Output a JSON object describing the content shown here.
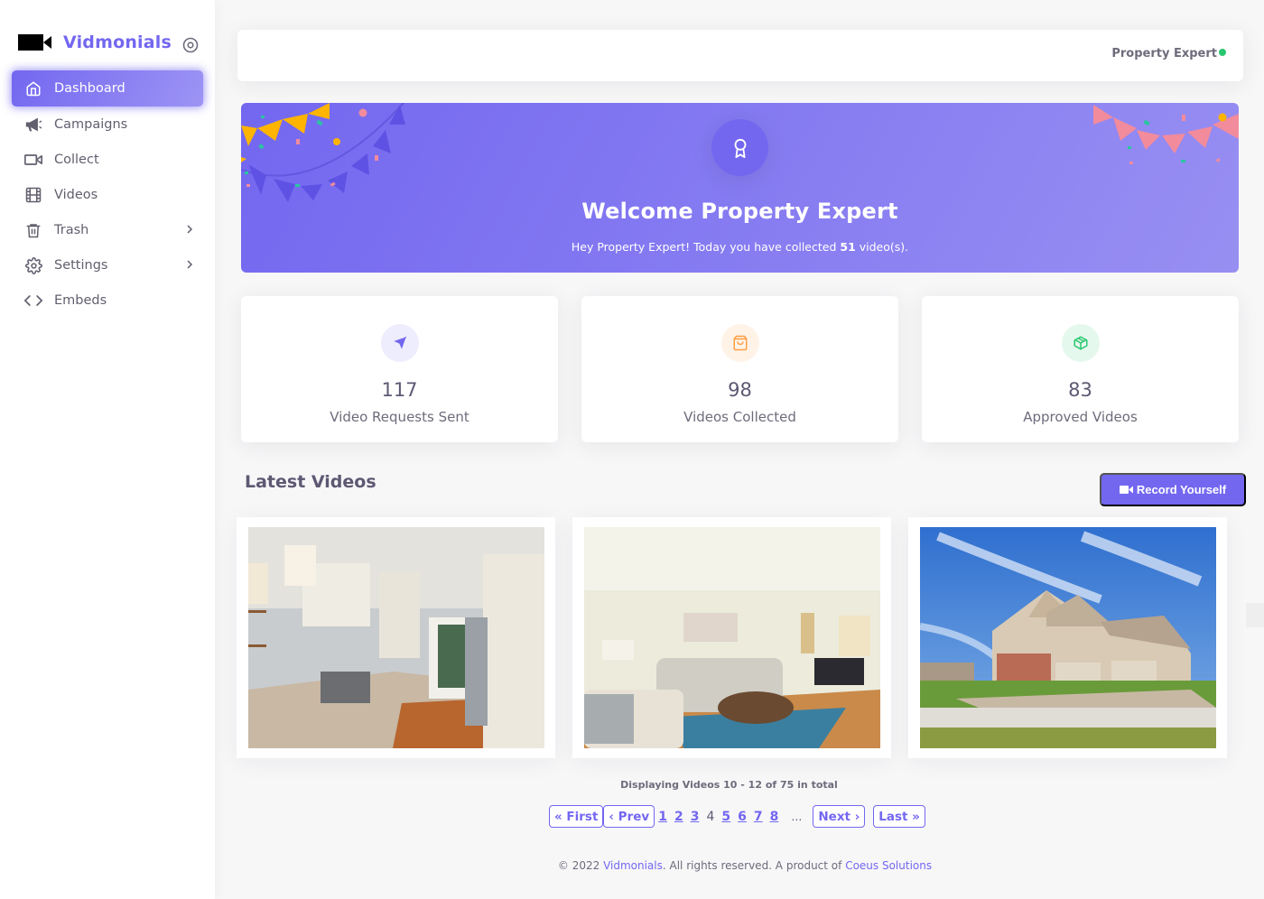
{
  "brand": {
    "name": "Vidmonials",
    "logo_icon": "video-camera-icon",
    "toggle_icon": "circle-dot-icon"
  },
  "sidebar": {
    "items": [
      {
        "label": "Dashboard",
        "icon": "home-icon",
        "active": true,
        "has_submenu": false
      },
      {
        "label": "Campaigns",
        "icon": "megaphone-icon",
        "active": false,
        "has_submenu": false
      },
      {
        "label": "Collect",
        "icon": "video-icon",
        "active": false,
        "has_submenu": false
      },
      {
        "label": "Videos",
        "icon": "film-icon",
        "active": false,
        "has_submenu": false
      },
      {
        "label": "Trash",
        "icon": "trash-icon",
        "active": false,
        "has_submenu": true
      },
      {
        "label": "Settings",
        "icon": "gear-icon",
        "active": false,
        "has_submenu": true
      },
      {
        "label": "Embeds",
        "icon": "code-icon",
        "active": false,
        "has_submenu": false
      }
    ]
  },
  "header": {
    "user_name": "Property Expert",
    "status": "online",
    "status_color": "#28c76f"
  },
  "banner": {
    "icon": "award-icon",
    "title": "Welcome Property Expert",
    "text_before": "Hey Property Expert! Today you have collected ",
    "count": "51",
    "text_after": " video(s)."
  },
  "stats": [
    {
      "value": "117",
      "label": "Video Requests Sent",
      "icon": "send-icon",
      "color": "#7367f0",
      "bg": "#eeedfd"
    },
    {
      "value": "98",
      "label": "Videos Collected",
      "icon": "shopping-bag-icon",
      "color": "#ff9f43",
      "bg": "#fff3e8"
    },
    {
      "value": "83",
      "label": "Approved Videos",
      "icon": "box-icon",
      "color": "#28c76f",
      "bg": "#e5f8ed"
    }
  ],
  "latest_videos": {
    "title": "Latest Videos",
    "record_button": "Record Yourself",
    "videos": [
      {
        "thumbnail": "kitchen interior"
      },
      {
        "thumbnail": "living room interior"
      },
      {
        "thumbnail": "house exterior"
      }
    ]
  },
  "pagination": {
    "info": "Displaying Videos 10 - 12 of 75 in total",
    "first": "« First",
    "prev": "‹ Prev",
    "pages": [
      "1",
      "2",
      "3",
      "4",
      "5",
      "6",
      "7",
      "8"
    ],
    "current": "4",
    "ellipsis": "…",
    "next": "Next ›",
    "last": "Last »"
  },
  "footer": {
    "prefix": "© 2022 ",
    "brand_link": "Vidmonials",
    "middle": ". All rights reserved. A product of ",
    "company_link": "Coeus Solutions"
  },
  "colors": {
    "primary": "#7367f0",
    "success": "#28c76f",
    "warning": "#ff9f43"
  }
}
